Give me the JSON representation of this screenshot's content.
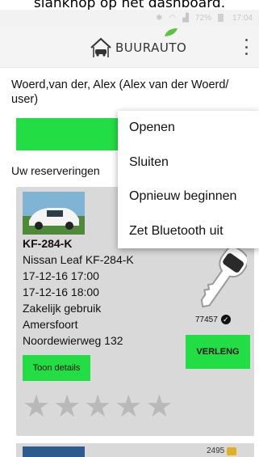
{
  "caption": "slanknop op het dashboard.",
  "statusbar": {
    "battery": "72%",
    "time": "17:04"
  },
  "appbar": {
    "brand_buur": "BUUR",
    "brand_auto": "AUTO"
  },
  "user_line": "Woerd,van der, Alex (Alex van der Woerd/ user)",
  "reservations_title": "Uw reserveringen",
  "reservation": {
    "plate": "KF-284-K",
    "car": "Nissan Leaf KF-284-K",
    "start": "17-12-16 17:00",
    "end": "17-12-16 18:00",
    "usage": "Zakelijk gebruik",
    "city": "Amersfoort",
    "street": "Noordewierweg 132",
    "details_label": "Toon details",
    "key_code": "77457",
    "extend_label": "VERLENG",
    "rating_stars": 0,
    "max_stars": 5
  },
  "next_reservation": {
    "code": "2495"
  },
  "menu": {
    "items": [
      "Openen",
      "Sluiten",
      "Opnieuw beginnen",
      "Zet Bluetooth uit"
    ]
  },
  "colors": {
    "accent_green": "#22dd44",
    "card_bg": "#d9d9d9"
  }
}
